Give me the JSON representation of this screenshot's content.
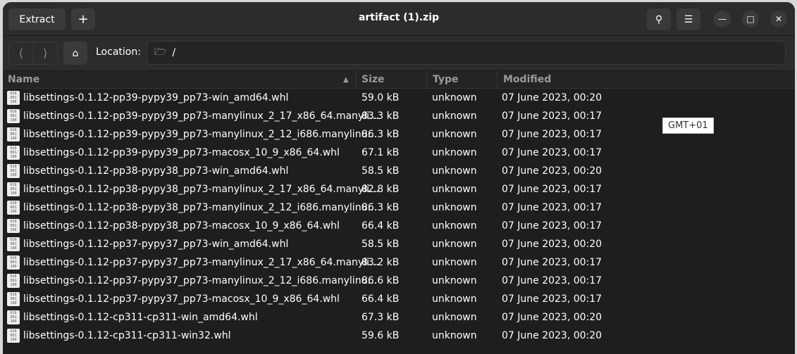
{
  "header": {
    "extract_label": "Extract",
    "add_label": "+",
    "title": "artifact (1).zip"
  },
  "location": {
    "label": "Location:",
    "path": "/"
  },
  "columns": {
    "name": "Name",
    "size": "Size",
    "type": "Type",
    "modified": "Modified"
  },
  "tooltip": "GMT+01",
  "files": [
    {
      "name": "libsettings-0.1.12-pp39-pypy39_pp73-win_amd64.whl",
      "size": "59.0 kB",
      "type": "unknown",
      "modified": "07 June 2023, 00:20"
    },
    {
      "name": "libsettings-0.1.12-pp39-pypy39_pp73-manylinux_2_17_x86_64.manyli…",
      "size": "83.3 kB",
      "type": "unknown",
      "modified": "07 June 2023, 00:17"
    },
    {
      "name": "libsettings-0.1.12-pp39-pypy39_pp73-manylinux_2_12_i686.manylinu…",
      "size": "86.3 kB",
      "type": "unknown",
      "modified": "07 June 2023, 00:17"
    },
    {
      "name": "libsettings-0.1.12-pp39-pypy39_pp73-macosx_10_9_x86_64.whl",
      "size": "67.1 kB",
      "type": "unknown",
      "modified": "07 June 2023, 00:17"
    },
    {
      "name": "libsettings-0.1.12-pp38-pypy38_pp73-win_amd64.whl",
      "size": "58.5 kB",
      "type": "unknown",
      "modified": "07 June 2023, 00:20"
    },
    {
      "name": "libsettings-0.1.12-pp38-pypy38_pp73-manylinux_2_17_x86_64.manyli…",
      "size": "82.8 kB",
      "type": "unknown",
      "modified": "07 June 2023, 00:17"
    },
    {
      "name": "libsettings-0.1.12-pp38-pypy38_pp73-manylinux_2_12_i686.manylinu…",
      "size": "86.3 kB",
      "type": "unknown",
      "modified": "07 June 2023, 00:17"
    },
    {
      "name": "libsettings-0.1.12-pp38-pypy38_pp73-macosx_10_9_x86_64.whl",
      "size": "66.4 kB",
      "type": "unknown",
      "modified": "07 June 2023, 00:17"
    },
    {
      "name": "libsettings-0.1.12-pp37-pypy37_pp73-win_amd64.whl",
      "size": "58.5 kB",
      "type": "unknown",
      "modified": "07 June 2023, 00:20"
    },
    {
      "name": "libsettings-0.1.12-pp37-pypy37_pp73-manylinux_2_17_x86_64.manyli…",
      "size": "83.2 kB",
      "type": "unknown",
      "modified": "07 June 2023, 00:17"
    },
    {
      "name": "libsettings-0.1.12-pp37-pypy37_pp73-manylinux_2_12_i686.manylinu…",
      "size": "86.6 kB",
      "type": "unknown",
      "modified": "07 June 2023, 00:17"
    },
    {
      "name": "libsettings-0.1.12-pp37-pypy37_pp73-macosx_10_9_x86_64.whl",
      "size": "66.4 kB",
      "type": "unknown",
      "modified": "07 June 2023, 00:17"
    },
    {
      "name": "libsettings-0.1.12-cp311-cp311-win_amd64.whl",
      "size": "67.3 kB",
      "type": "unknown",
      "modified": "07 June 2023, 00:20"
    },
    {
      "name": "libsettings-0.1.12-cp311-cp311-win32.whl",
      "size": "59.6 kB",
      "type": "unknown",
      "modified": "07 June 2023, 00:20"
    }
  ]
}
